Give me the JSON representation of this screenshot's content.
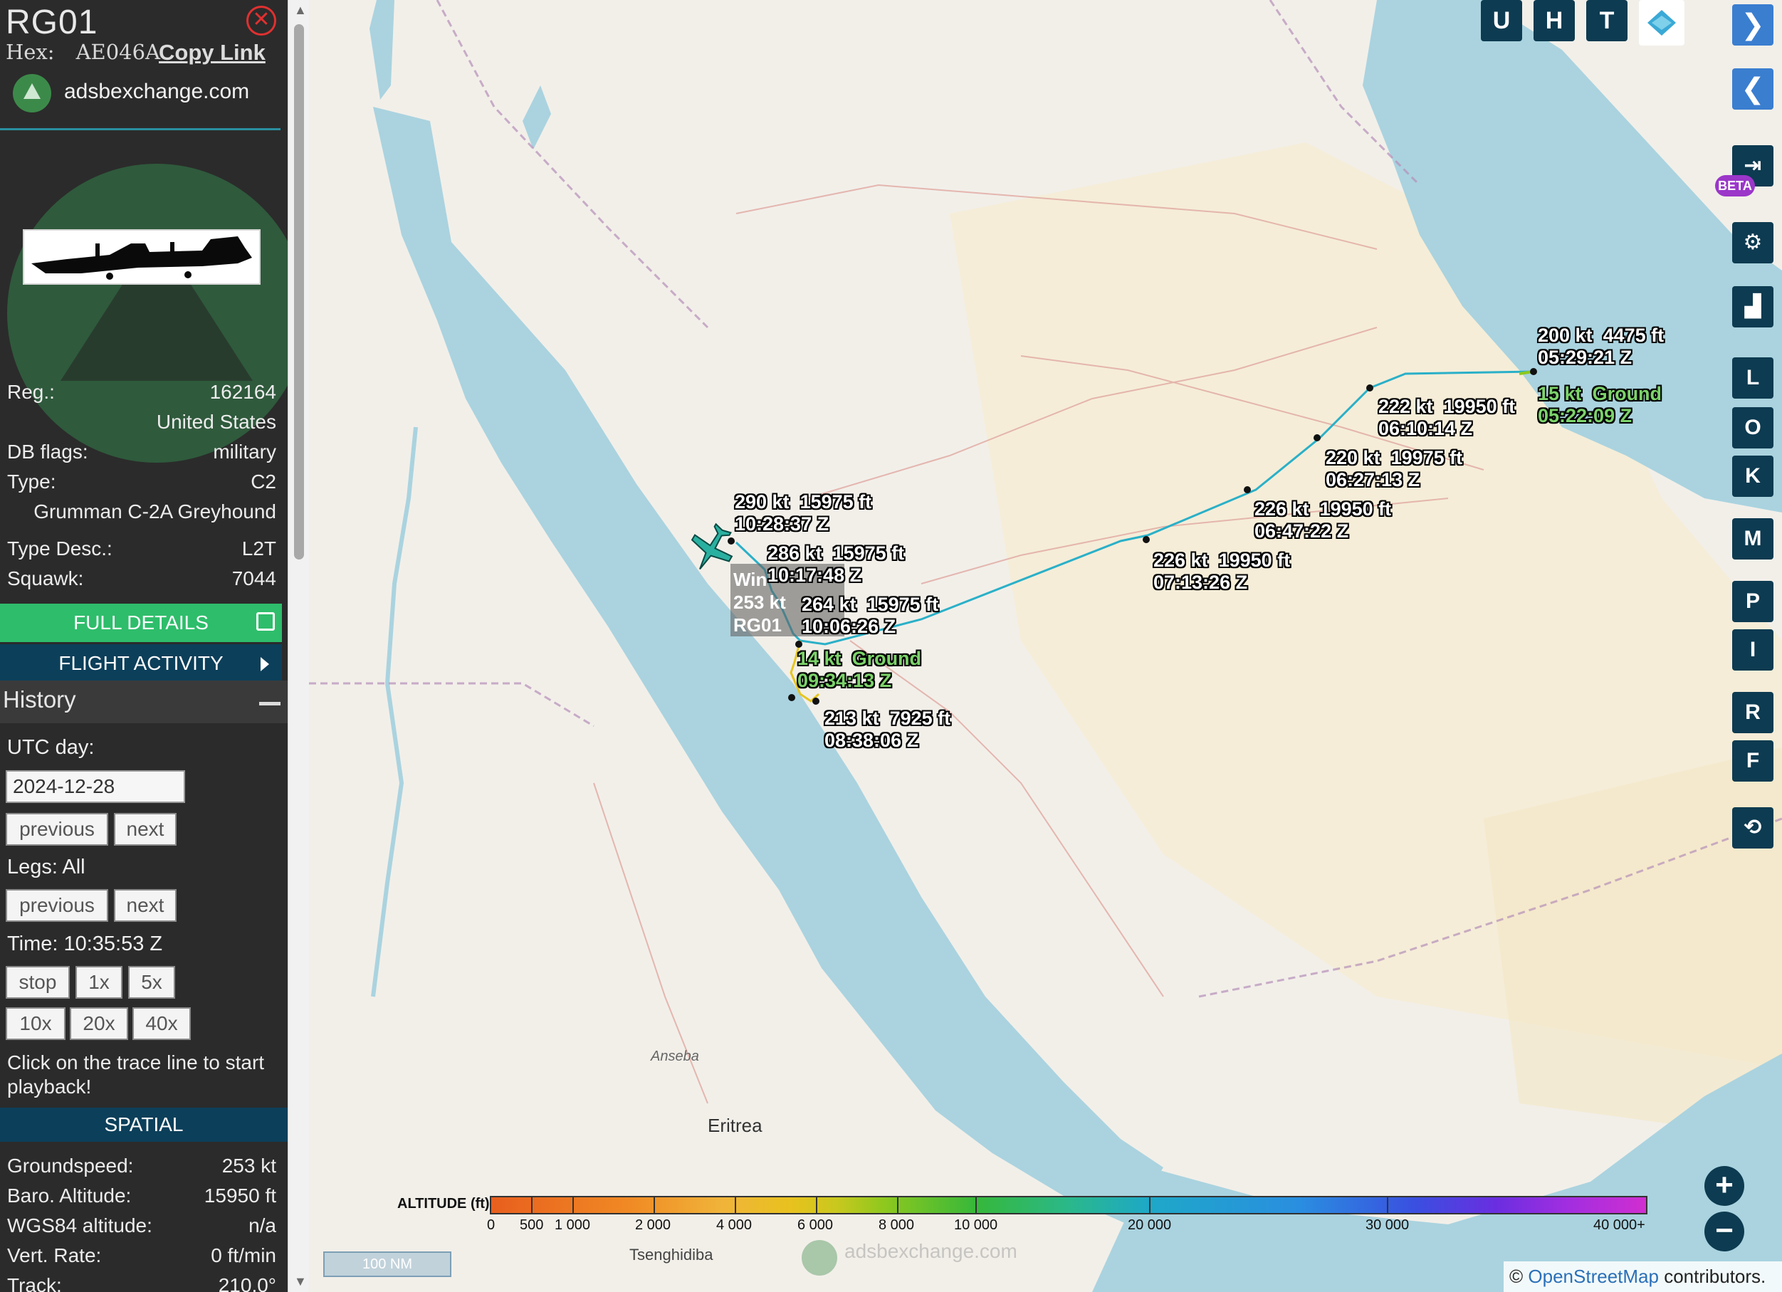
{
  "aircraft": {
    "callsign": "RG01",
    "hex_label": "Hex:",
    "hex": "AE046A",
    "copy_link": "Copy Link",
    "source": "adsbexchange.com"
  },
  "details": {
    "reg_label": "Reg.:",
    "reg": "162164",
    "country": "United States",
    "db_flags_label": "DB flags:",
    "db_flags": "military",
    "type_label": "Type:",
    "type": "C2",
    "type_name": "Grumman C-2A Greyhound",
    "type_desc_label": "Type Desc.:",
    "type_desc": "L2T",
    "squawk_label": "Squawk:",
    "squawk": "7044"
  },
  "buttons": {
    "full_details": "FULL DETAILS",
    "flight_activity": "FLIGHT ACTIVITY"
  },
  "history": {
    "title": "History",
    "utc_day_label": "UTC day:",
    "date": "2024-12-28",
    "previous": "previous",
    "next": "next",
    "legs_label": "Legs: All",
    "time_label": "Time: 10:35:53 Z",
    "speeds": [
      "stop",
      "1x",
      "5x",
      "10x",
      "20x",
      "40x"
    ],
    "help": "Click on the trace line to start playback!"
  },
  "spatial": {
    "title": "SPATIAL",
    "rows": [
      {
        "label": "Groundspeed:",
        "value": "253 kt"
      },
      {
        "label": "Baro. Altitude:",
        "value": "15950 ft"
      },
      {
        "label": "WGS84 altitude:",
        "value": "n/a"
      },
      {
        "label": "Vert. Rate:",
        "value": "0 ft/min"
      },
      {
        "label": "Track:",
        "value": "210.0°"
      }
    ]
  },
  "map": {
    "callouts": [
      {
        "speed": "200 kt",
        "alt": "4475 ft",
        "time": "05:29:21 Z",
        "green": false
      },
      {
        "speed": "15 kt",
        "alt": "Ground",
        "time": "05:22:09 Z",
        "green": true
      },
      {
        "speed": "222 kt",
        "alt": "19950 ft",
        "time": "06:10:14 Z",
        "green": false
      },
      {
        "speed": "220 kt",
        "alt": "19975 ft",
        "time": "06:27:13 Z",
        "green": false
      },
      {
        "speed": "226 kt",
        "alt": "19950 ft",
        "time": "06:47:22 Z",
        "green": false
      },
      {
        "speed": "226 kt",
        "alt": "19950 ft",
        "time": "07:13:26 Z",
        "green": false
      },
      {
        "speed": "290 kt",
        "alt": "15975 ft",
        "time": "10:28:37 Z",
        "green": false
      },
      {
        "speed": "286 kt",
        "alt": "15975 ft",
        "time": "10:17:48 Z",
        "green": false
      },
      {
        "speed": "264 kt",
        "alt": "15975 ft",
        "time": "10:06:26 Z",
        "green": false
      },
      {
        "speed": "14 kt",
        "alt": "Ground",
        "time": "09:34:13 Z",
        "green": true
      },
      {
        "speed": "213 kt",
        "alt": "7925 ft",
        "time": "08:38:06 Z",
        "green": false
      }
    ],
    "aircraft_label": {
      "line1": "Win",
      "line2": "253 kt",
      "line3": "RG01"
    },
    "top_buttons": [
      "U",
      "H",
      "T"
    ],
    "side_buttons": [
      "L",
      "O",
      "K",
      "M",
      "P",
      "I",
      "R",
      "F"
    ],
    "beta": "BETA",
    "scale": "100 NM",
    "attribution_prefix": "©",
    "attribution_link": "OpenStreetMap",
    "attribution_suffix": "contributors.",
    "watermark": "adsbexchange.com",
    "place_labels": [
      {
        "text": "Eritrea"
      },
      {
        "text": "Anseba"
      },
      {
        "text": "Tsenghidiba"
      }
    ]
  },
  "legend": {
    "title": "ALTITUDE (ft)",
    "labels": [
      "0",
      "500",
      "1 000",
      "2 000",
      "4 000",
      "6 000",
      "8 000",
      "10 000",
      "20 000",
      "30 000",
      "40 000+"
    ]
  },
  "colors": {
    "accent_green": "#2ebd6b",
    "navy": "#0c3f5a",
    "sea": "#aad3df",
    "track": "#2ab0c8"
  }
}
